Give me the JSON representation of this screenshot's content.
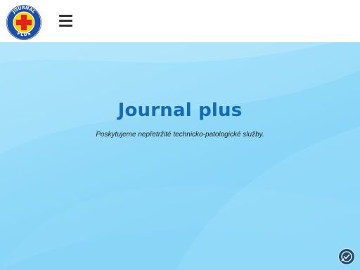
{
  "header": {
    "logo_text_top": "JOURNAL",
    "logo_text_bottom": "PLUS",
    "menu_icon": "hamburger-menu-icon"
  },
  "hero": {
    "title": "Journal plus",
    "subtitle": "Poskytujeme nepřetržité technicko-patologické služby."
  },
  "widgets": {
    "accessibility_icon": "accessibility-check-icon"
  },
  "colors": {
    "title": "#136bb4",
    "hero_light": "#a9e4fb",
    "hero_dark": "#7cd0f6",
    "logo_blue": "#1e4fa3",
    "logo_red": "#e2231a",
    "logo_yellow": "#f7d117",
    "widget": "#1f4e78"
  }
}
